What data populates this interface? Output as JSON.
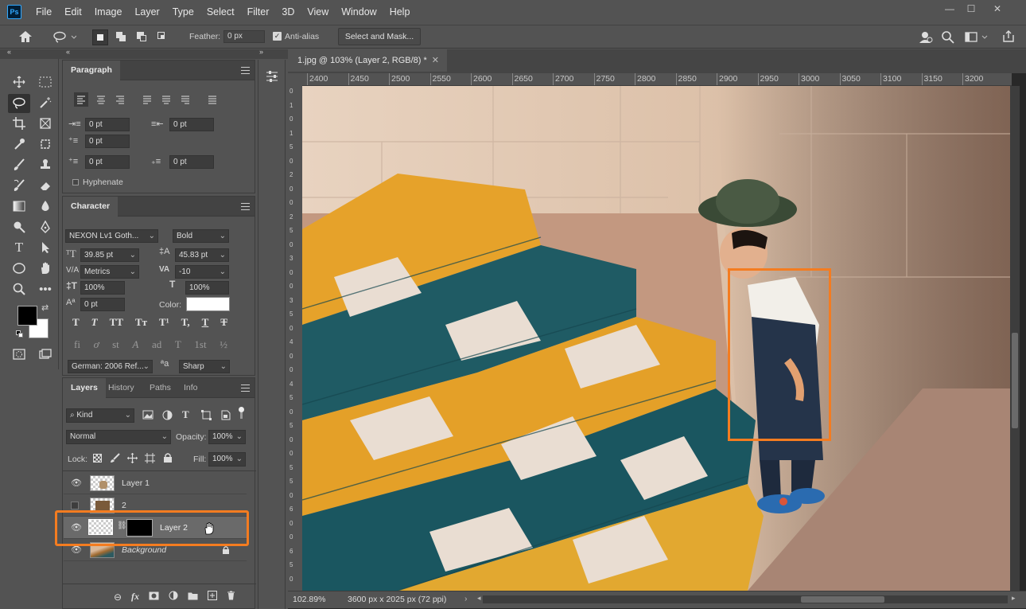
{
  "app": {
    "logo": "Ps"
  },
  "menu": [
    "File",
    "Edit",
    "Image",
    "Layer",
    "Type",
    "Select",
    "Filter",
    "3D",
    "View",
    "Window",
    "Help"
  ],
  "window_controls": {
    "minimize": "—",
    "maximize": "☐",
    "close": "✕"
  },
  "options": {
    "feather_label": "Feather:",
    "feather_value": "0 px",
    "antialias_label": "Anti-alias",
    "select_mask_label": "Select and Mask..."
  },
  "paragraph": {
    "tab": "Paragraph",
    "indent_left": "0 pt",
    "indent_right": "0 pt",
    "indent_first": "0 pt",
    "space_before": "0 pt",
    "space_after": "0 pt",
    "hyphenate": "Hyphenate"
  },
  "character": {
    "tab": "Character",
    "font_family": "NEXON Lv1 Goth...",
    "font_style": "Bold",
    "font_size": "39.85 pt",
    "leading": "45.83 pt",
    "kerning": "Metrics",
    "tracking": "-10",
    "vscale": "100%",
    "hscale": "100%",
    "baseline": "0 pt",
    "color_label": "Color:",
    "text_color": "#ffffff",
    "style_buttons": [
      "T",
      "T",
      "TT",
      "Tт",
      "T¹",
      "T,",
      "T",
      "T"
    ],
    "opentype_buttons": [
      "fi",
      "ơ",
      "st",
      "A",
      "ad",
      "T",
      "1st",
      "½"
    ],
    "language": "German:  2006  Ref...",
    "aa_icon": "ªa",
    "antialias": "Sharp"
  },
  "layers_panel": {
    "tabs": [
      "Layers",
      "History",
      "Paths",
      "Info"
    ],
    "filter_kind": "Kind",
    "blend_mode": "Normal",
    "opacity_label": "Opacity:",
    "opacity": "100%",
    "lock_label": "Lock:",
    "fill_label": "Fill:",
    "fill": "100%",
    "layers": [
      {
        "name": "Layer 1",
        "visible": true
      },
      {
        "name": "2",
        "visible": false
      },
      {
        "name": "Layer 2",
        "visible": true,
        "selected": true
      },
      {
        "name": "Background",
        "visible": true,
        "locked": true
      }
    ],
    "bottom_icons": [
      "link-icon",
      "fx-icon",
      "mask-icon",
      "adjustment-icon",
      "folder-icon",
      "new-layer-icon",
      "trash-icon"
    ]
  },
  "document": {
    "tab_title": "1.jpg @ 103% (Layer 2, RGB/8) *",
    "zoom": "102.89%",
    "dimensions": "3600 px x 2025 px (72 ppi)"
  },
  "ruler": {
    "top_ticks": [
      "2400",
      "2450",
      "2500",
      "2550",
      "2600",
      "2650",
      "2700",
      "2750",
      "2800",
      "2850",
      "2900",
      "2950",
      "3000",
      "3050",
      "3100",
      "3150",
      "3200"
    ],
    "left_ticks": [
      "0",
      "1",
      "0",
      "1",
      "5",
      "0",
      "2",
      "0",
      "0",
      "2",
      "5",
      "0",
      "3",
      "0",
      "0",
      "3",
      "5",
      "0",
      "4",
      "0",
      "0",
      "4",
      "5",
      "0",
      "5",
      "0",
      "0",
      "5",
      "5",
      "0",
      "6",
      "0",
      "0",
      "6",
      "5",
      "0"
    ]
  },
  "colors": {
    "highlight": "#f47c20",
    "foreground": "#000000",
    "background": "#ffffff",
    "accent": "#31a8ff"
  }
}
